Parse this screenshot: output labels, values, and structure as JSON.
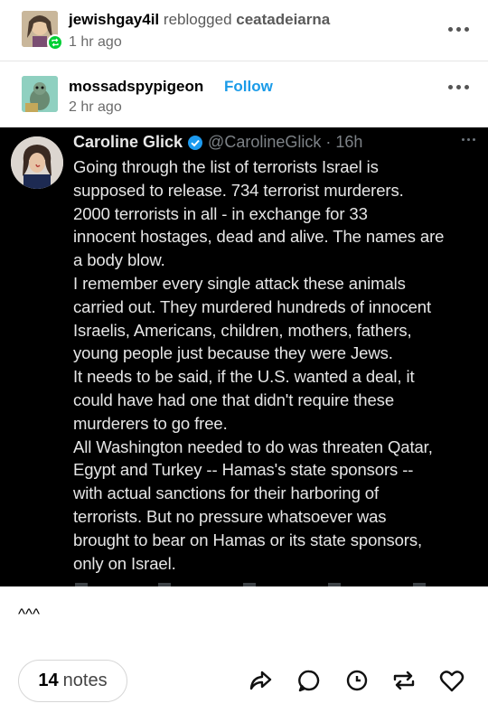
{
  "reblog": {
    "username": "jewishgay4il",
    "verb": "reblogged",
    "source": "ceatadeiarna",
    "time": "1 hr ago"
  },
  "post": {
    "author": "mossadspypigeon",
    "follow_label": "Follow",
    "time": "2 hr ago"
  },
  "tweet": {
    "name": "Caroline Glick",
    "handle_time": "@CarolineGlick · 16h",
    "lines": [
      "Going through the list of terrorists Israel is",
      "supposed to release. 734 terrorist murderers.",
      "2000 terrorists in all - in exchange for 33",
      "innocent hostages, dead and alive. The names are",
      "a body blow.",
      "I remember every single attack these animals",
      "carried out. They murdered hundreds of innocent",
      "Israelis, Americans, children, mothers, fathers,",
      "young people just because they were Jews.",
      "It needs to be said, if the U.S. wanted a deal, it",
      "could have had one that didn't require these",
      "murderers to go free.",
      "All Washington needed to do was threaten Qatar,",
      "Egypt and Turkey -- Hamas's state sponsors --",
      "with actual sanctions for their harboring of",
      "terrorists. But no pressure whatsoever was",
      "brought to bear on Hamas or its state sponsors,",
      "only on Israel."
    ]
  },
  "caption": "^^^",
  "footer": {
    "notes_count": "14",
    "notes_label": "notes"
  },
  "colors": {
    "follow": "#1a9be8",
    "reblog_badge": "#00cf35",
    "tweet_bg": "#000000",
    "verified": "#1d9bf0"
  },
  "icons": [
    "reblog-icon",
    "more-options-icon",
    "verified-badge-icon",
    "share-icon",
    "reply-icon",
    "clock-icon",
    "reblog-action-icon",
    "like-icon"
  ]
}
